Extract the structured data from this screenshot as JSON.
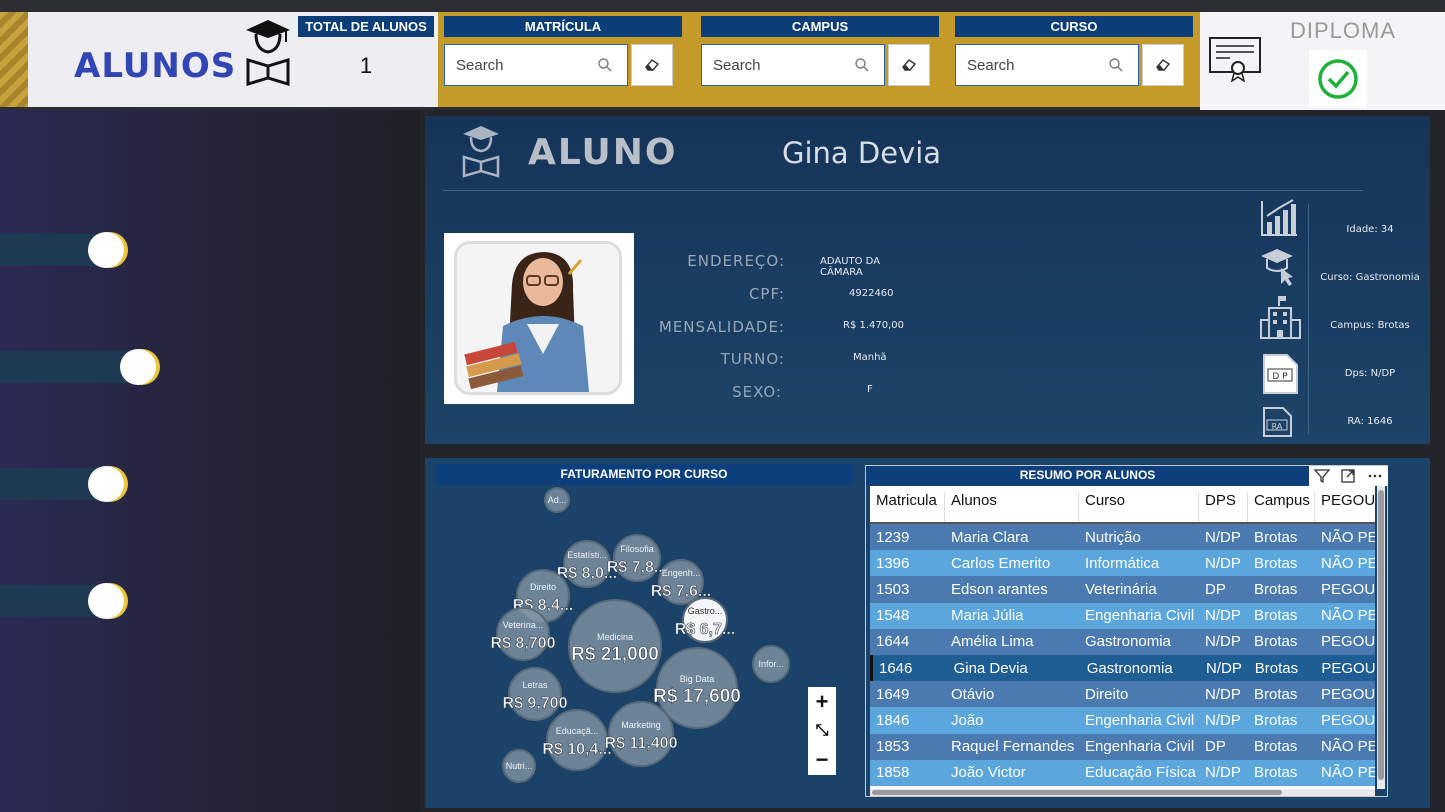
{
  "header": {
    "title": "ALUNOS",
    "total_label": "TOTAL DE ALUNOS",
    "total_value": "1",
    "filters": [
      {
        "label": "MATRÍCULA",
        "placeholder": "Search"
      },
      {
        "label": "CAMPUS",
        "placeholder": "Search"
      },
      {
        "label": "CURSO",
        "placeholder": "Search"
      }
    ],
    "diploma_label": "DIPLOMA"
  },
  "colors": {
    "accent_blue": "#0b3d78",
    "gold": "#c49a28",
    "check_green": "#1db13a",
    "card_bg": "#1b4268"
  },
  "student": {
    "section_title": "ALUNO",
    "name": "Gina Devia",
    "fields": [
      {
        "label": "ENDEREÇO:",
        "value": "ADAUTO DA CÂMARA"
      },
      {
        "label": "CPF:",
        "value": "4922460"
      },
      {
        "label": "MENSALIDADE:",
        "value": "R$ 1.470,00"
      },
      {
        "label": "TURNO:",
        "value": "Manhã"
      },
      {
        "label": "SEXO:",
        "value": "F"
      }
    ],
    "side_info": [
      {
        "icon": "growth-chart-icon",
        "value": "Idade: 34"
      },
      {
        "icon": "graduation-click-icon",
        "value": "Curso: Gastronomia"
      },
      {
        "icon": "building-icon",
        "value": "Campus: Brotas"
      },
      {
        "icon": "dp-document-icon",
        "value": "Dps: N/DP"
      },
      {
        "icon": "ra-document-icon",
        "value": "RA: 1646"
      }
    ]
  },
  "faturamento": {
    "title": "FATURAMENTO POR CURSO",
    "bubbles": [
      {
        "name": "Ad..."
      },
      {
        "name": "Estatísti...",
        "value": "R$ 8,0..."
      },
      {
        "name": "Filosofia",
        "value": "R$ 7,8..."
      },
      {
        "name": "Engenh...",
        "value": "R$ 7,6..."
      },
      {
        "name": "Direito",
        "value": "R$ 8,4..."
      },
      {
        "name": "Gastro...",
        "value": "R$ 6,7..."
      },
      {
        "name": "Veterina...",
        "value": "R$ 8,700"
      },
      {
        "name": "Medicina",
        "value": "R$ 21,000"
      },
      {
        "name": "Infor..."
      },
      {
        "name": "Big Data",
        "value": "R$ 17,600"
      },
      {
        "name": "Letras",
        "value": "R$ 9,700"
      },
      {
        "name": "Educaçã...",
        "value": "R$ 10,4..."
      },
      {
        "name": "Marketing",
        "value": "R$ 11,400"
      },
      {
        "name": "Nutri..."
      }
    ],
    "zoom": {
      "in": "+",
      "fit": "⤡",
      "out": "−"
    }
  },
  "table": {
    "title": "RESUMO POR ALUNOS",
    "columns": [
      "Matricula",
      "Alunos",
      "Curso",
      "DPS",
      "Campus",
      "PEGOU"
    ],
    "rows": [
      [
        "1239",
        "Maria Clara",
        "Nutrição",
        "N/DP",
        "Brotas",
        "NÃO PE"
      ],
      [
        "1396",
        "Carlos Emerito",
        "Informática",
        "N/DP",
        "Brotas",
        "NÃO PE"
      ],
      [
        "1503",
        "Edson arantes",
        "Veterinária",
        "DP",
        "Brotas",
        "PEGOU"
      ],
      [
        "1548",
        "Maria Júlia",
        "Engenharia Civil",
        "N/DP",
        "Brotas",
        "NÃO PE"
      ],
      [
        "1644",
        "Amélia Lima",
        "Gastronomia",
        "N/DP",
        "Brotas",
        "PEGOU"
      ],
      [
        "1646",
        "Gina Devia",
        "Gastronomia",
        "N/DP",
        "Brotas",
        "PEGOU"
      ],
      [
        "1649",
        "Otávio",
        "Direito",
        "N/DP",
        "Brotas",
        "PEGOU"
      ],
      [
        "1846",
        "João",
        "Engenharia Civil",
        "N/DP",
        "Brotas",
        "PEGOU"
      ],
      [
        "1853",
        "Raquel Fernandes",
        "Engenharia Civil",
        "DP",
        "Brotas",
        "NÃO PE"
      ],
      [
        "1858",
        "João Victor",
        "Educação Física",
        "N/DP",
        "Brotas",
        "NÃO PE"
      ]
    ],
    "selected_row": "1646"
  }
}
